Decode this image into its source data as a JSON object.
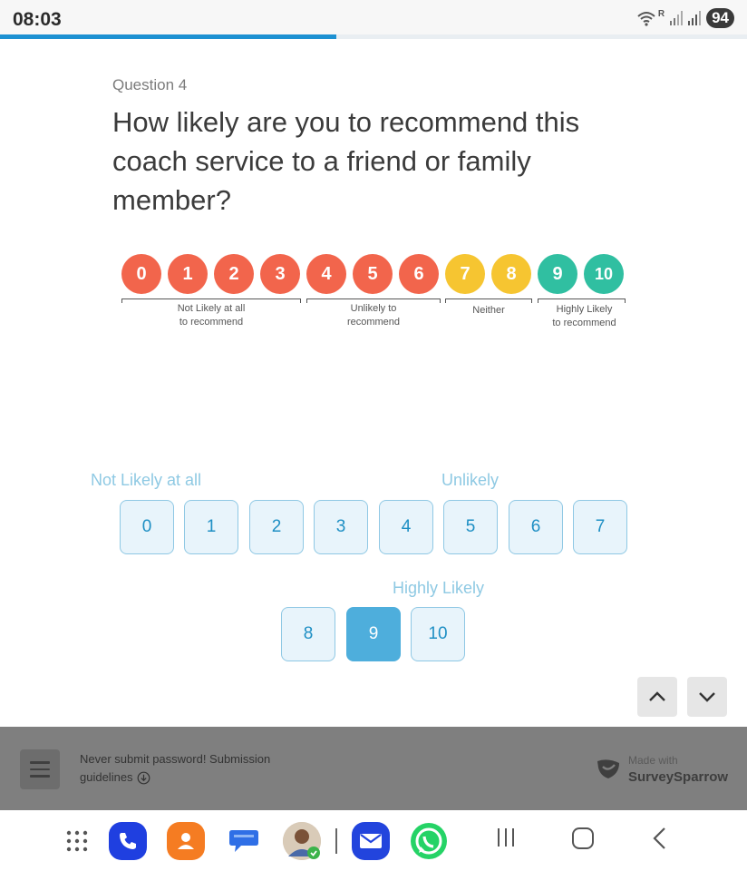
{
  "status_bar": {
    "time": "08:03",
    "battery": "94",
    "signal_label": "R"
  },
  "progress": {
    "fraction": 0.45
  },
  "question": {
    "number_label": "Question 4",
    "title": "How likely are you to recommend this coach service to a friend or family member?"
  },
  "nps_image": {
    "numbers": [
      "0",
      "1",
      "2",
      "3",
      "4",
      "5",
      "6",
      "7",
      "8",
      "9",
      "10"
    ],
    "colors": {
      "red": "#f2654c",
      "yellow": "#f6c531",
      "teal": "#30bfa1"
    },
    "groups": [
      {
        "line1": "Not Likely at all",
        "line2": "to recommend"
      },
      {
        "line1": "Unlikely to",
        "line2": "recommend"
      },
      {
        "line1": "Neither",
        "line2": ""
      },
      {
        "line1": "Highly Likely",
        "line2": "to recommend"
      }
    ]
  },
  "scale": {
    "label_low": "Not Likely at all",
    "label_mid": "Unlikely",
    "label_high": "Highly Likely",
    "options": [
      "0",
      "1",
      "2",
      "3",
      "4",
      "5",
      "6",
      "7",
      "8",
      "9",
      "10"
    ],
    "selected": "9"
  },
  "navigation": {
    "up_icon": "chevron-up-icon",
    "down_icon": "chevron-down-icon"
  },
  "footer": {
    "note": "Never submit password! Submission guidelines",
    "note_line1": "Never submit password! Submission",
    "note_line2": "guidelines",
    "made_with": "Made with",
    "brand": "SurveySparrow"
  },
  "android_nav": {
    "apps": [
      "apps-grid-icon",
      "phone-icon",
      "contacts-icon",
      "messages-icon",
      "contact-avatar",
      "email-icon",
      "whatsapp-icon"
    ],
    "system": [
      "recents-icon",
      "home-icon",
      "back-icon"
    ]
  }
}
